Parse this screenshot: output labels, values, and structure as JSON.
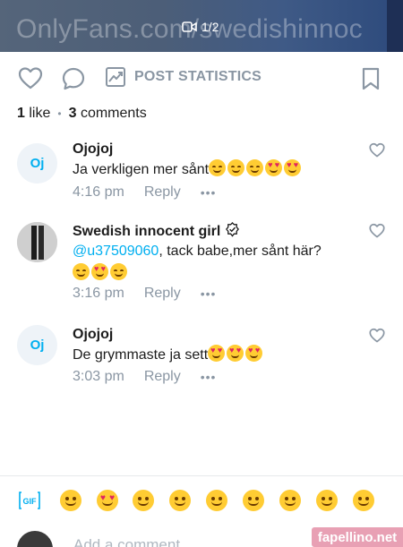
{
  "media": {
    "watermark": "OnlyFans.com/swedishinnoc",
    "counter": "1/2"
  },
  "actions": {
    "stats_label": "POST STATISTICS"
  },
  "counts": {
    "likes_num": "1",
    "likes_label": "like",
    "separator": "•",
    "comments_num": "3",
    "comments_label": "comments"
  },
  "comments": [
    {
      "avatar_initials": "Oj",
      "name": "Ojojoj",
      "text": "Ja verkligen mer sånt",
      "emojis": [
        "smiling-face",
        "smiling-face",
        "smiling-face",
        "heart-eyes",
        "heart-eyes"
      ],
      "time": "4:16 pm",
      "reply": "Reply",
      "more": "•••"
    },
    {
      "avatar_initials": "",
      "name": "Swedish innocent girl",
      "mention": "@u37509060",
      "text": ", tack babe,mer sånt här?",
      "emojis": [
        "smirk",
        "heart-eyes",
        "smiling-face"
      ],
      "time": "3:16 pm",
      "reply": "Reply",
      "more": "•••"
    },
    {
      "avatar_initials": "Oj",
      "name": "Ojojoj",
      "text": "De grymmaste ja sett",
      "emojis": [
        "heart-eyes",
        "heart-eyes",
        "heart-eyes"
      ],
      "time": "3:03 pm",
      "reply": "Reply",
      "more": "•••"
    }
  ],
  "emoji_bar": {
    "gif_label": "GIF",
    "emojis": [
      "smiling-face",
      "heart-eyes",
      "smirk",
      "grinning",
      "grin",
      "joy",
      "smiley",
      "smile",
      "sweat-smile"
    ]
  },
  "composer": {
    "placeholder": "Add a comment"
  },
  "watermark_site": "fapellino.net",
  "colors": {
    "accent": "#00aff0",
    "muted": "#8a96a3",
    "text": "#1c1c1c"
  }
}
